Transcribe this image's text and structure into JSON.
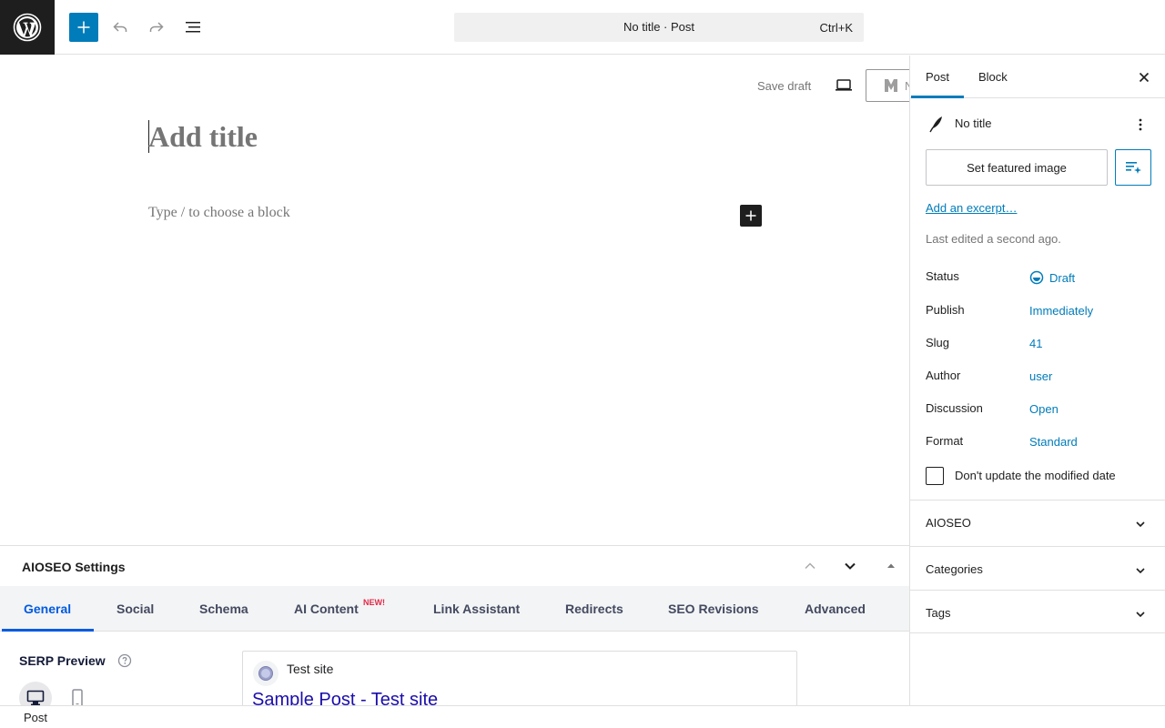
{
  "topbar": {
    "logo_icon": "wordpress-logo-icon",
    "add_block_icon": "plus-icon",
    "undo_icon": "undo-icon",
    "redo_icon": "redo-icon",
    "document_overview_icon": "list-view-icon",
    "command_title": "No title · Post",
    "command_shortcut": "Ctrl+K"
  },
  "editor": {
    "save_draft": "Save draft",
    "preview_icon": "desktop-preview-icon",
    "aioseo_button_label": "N",
    "title_placeholder": "Add title",
    "block_placeholder": "Type / to choose a block",
    "inserter_icon": "plus-icon"
  },
  "metabox": {
    "title": "AIOSEO Settings",
    "tabs": [
      {
        "label": "General",
        "active": true
      },
      {
        "label": "Social"
      },
      {
        "label": "Schema"
      },
      {
        "label": "AI Content",
        "badge": "NEW!"
      },
      {
        "label": "Link Assistant"
      },
      {
        "label": "Redirects"
      },
      {
        "label": "SEO Revisions"
      },
      {
        "label": "Advanced"
      }
    ],
    "serp_label": "SERP Preview",
    "serp_site": "Test site",
    "serp_title": "Sample Post - Test site"
  },
  "sidebar": {
    "tabs": [
      "Post",
      "Block"
    ],
    "active_tab": "Post",
    "post_title": "No title",
    "featured_image": "Set featured image",
    "excerpt": "Add an excerpt…",
    "last_edited": "Last edited a second ago.",
    "meta": [
      {
        "label": "Status",
        "value": "Draft"
      },
      {
        "label": "Publish",
        "value": "Immediately"
      },
      {
        "label": "Slug",
        "value": "41"
      },
      {
        "label": "Author",
        "value": "user"
      },
      {
        "label": "Discussion",
        "value": "Open"
      },
      {
        "label": "Format",
        "value": "Standard"
      }
    ],
    "checkbox_label": "Don't update the modified date",
    "panels": [
      "AIOSEO",
      "Categories",
      "Tags"
    ]
  },
  "footer": {
    "breadcrumb": "Post"
  },
  "colors": {
    "accent": "#007cba",
    "aioseo_blue": "#005ae0",
    "dark": "#1e1e1e",
    "badge_red": "#df2a4a"
  }
}
